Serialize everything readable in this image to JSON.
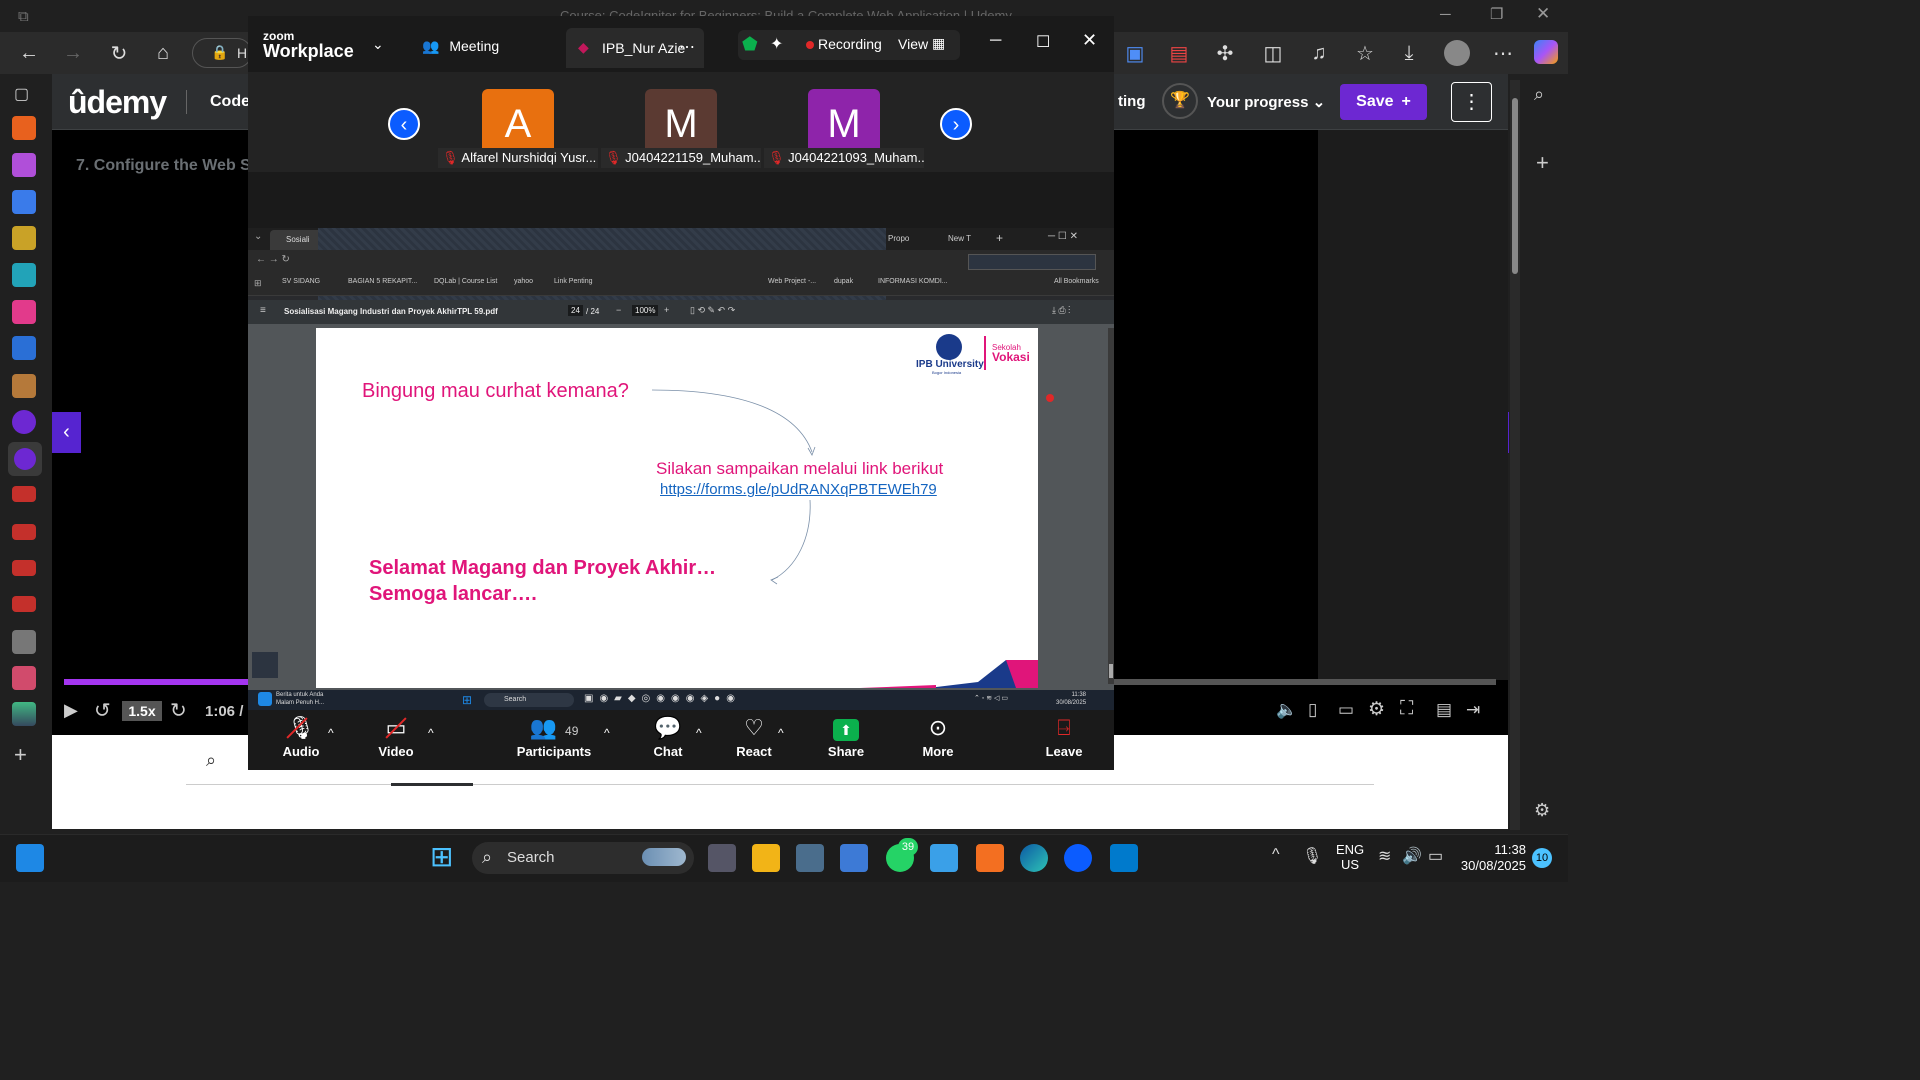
{
  "edge": {
    "title": "Course: CodeIgniter for Beginners: Build a Complete Web Application | Udemy",
    "address_fragment": "H"
  },
  "udemy": {
    "logo": "ûdemy",
    "course_title": "Code",
    "lecture_title": "7. Configure the Web Se",
    "rating_fragment": "ting",
    "progress_label": "Your progress",
    "save_label": "Save",
    "speed": "1.5x",
    "time": "1:06 /"
  },
  "zoom": {
    "brand_top": "zoom",
    "brand": "Workplace",
    "tab_meeting": "Meeting",
    "tab_host": "IPB_Nur Azie",
    "recording": "Recording",
    "view": "View",
    "participants": [
      {
        "initial": "A",
        "name": "Alfarel Nurshidqi Yusr...",
        "color": "#e8700f"
      },
      {
        "initial": "M",
        "name": "J0404221159_Muham...",
        "color": "#5b3a32"
      },
      {
        "initial": "M",
        "name": "J0404221093_Muham...",
        "color": "#8e24aa"
      }
    ],
    "controls": {
      "audio": "Audio",
      "video": "Video",
      "participants": "Participants",
      "participants_count": "49",
      "chat": "Chat",
      "react": "React",
      "share": "Share",
      "more": "More",
      "leave": "Leave"
    }
  },
  "shared": {
    "tab1": "Sosiali",
    "tab2": "Propo",
    "tab3": "New T",
    "bookmarks": [
      "SV SIDANG",
      "BAGIAN 5 REKAPIT...",
      "DQLab | Course List",
      "yahoo",
      "Link Penting"
    ],
    "bookmarks_right": [
      "Web Project -...",
      "dupak",
      "INFORMASI KOMDI..."
    ],
    "all_bookmarks": "All Bookmarks",
    "pdf_title": "Sosialisasi Magang Industri dan Proyek AkhirTPL 59.pdf",
    "page_current": "24",
    "page_total": "/ 24",
    "zoom_level": "100%",
    "logo_uni": "IPB University",
    "logo_uni_sub": "Bogor Indonesia",
    "logo_school": "Sekolah",
    "logo_vokasi": "Vokasi",
    "heading": "Bingung mau curhat kemana?",
    "line2": "Silakan sampaikan melalui link berikut",
    "link": "https://forms.gle/pUdRANXqPBTEWEh79",
    "closing1": "Selamat Magang dan Proyek Akhir…",
    "closing2": "Semoga lancar….",
    "news": "Berita untuk Anda",
    "news2": "Malam Penuh H...",
    "search": "Search",
    "time": "11:38",
    "date": "30/08/2025"
  },
  "taskbar": {
    "search": "Search",
    "whatsapp_badge": "39",
    "lang": "ENG",
    "region": "US",
    "time": "11:38",
    "date": "30/08/2025",
    "notif": "10"
  },
  "colors": {
    "udemy_purple": "#a435f0",
    "save_purple": "#6d28d2",
    "slide_pink": "#e0157a",
    "zoom_blue": "#0b5cff",
    "share_green": "#0bb04d"
  }
}
